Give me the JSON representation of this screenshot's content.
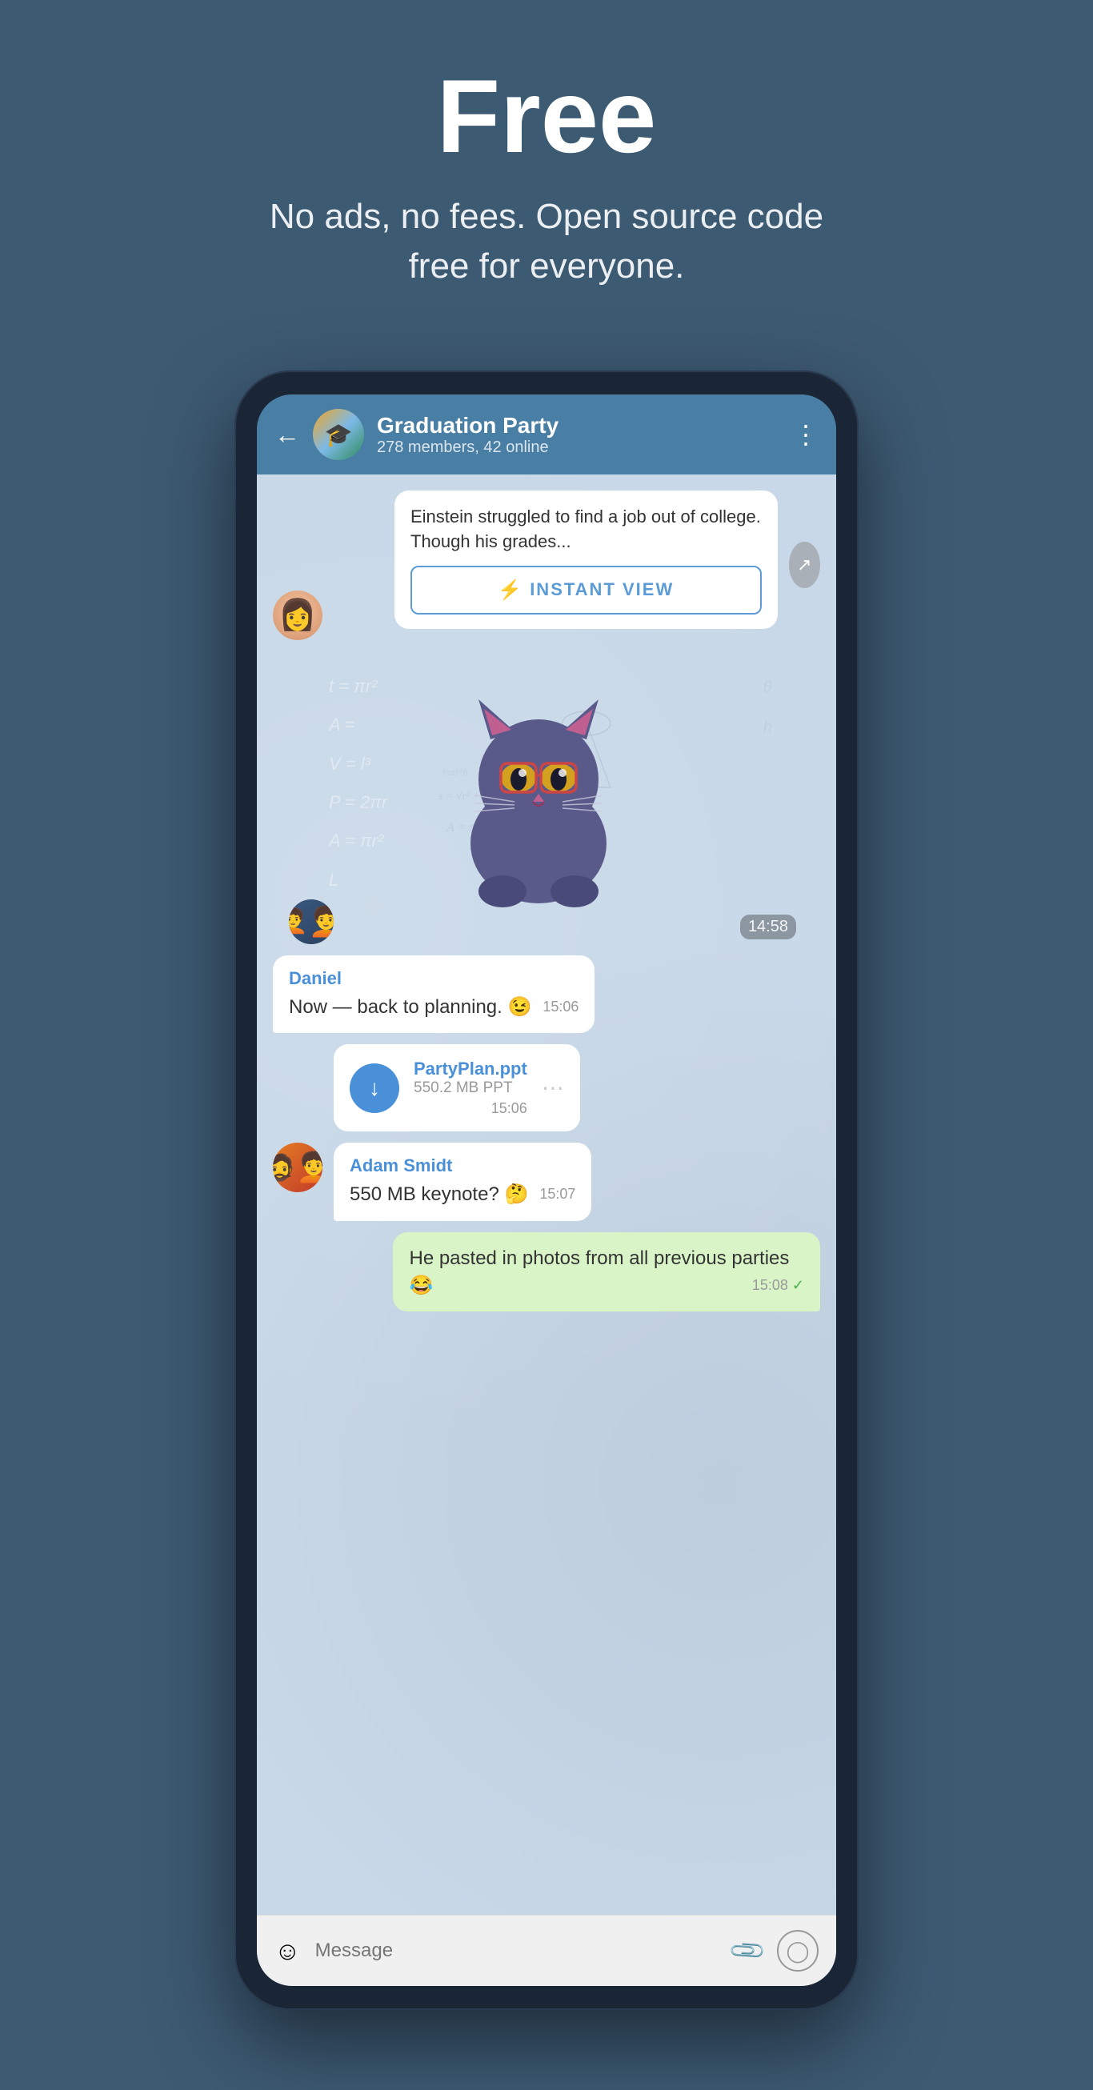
{
  "hero": {
    "title": "Free",
    "subtitle": "No ads, no fees. Open source code free for everyone."
  },
  "phone": {
    "header": {
      "back_label": "←",
      "group_name": "Graduation Party",
      "group_members": "278 members, 42 online",
      "menu_label": "⋮"
    },
    "messages": [
      {
        "type": "instant_view",
        "text": "Einstein struggled to find a job out of college. Though his grades...",
        "button_label": "INSTANT VIEW",
        "lightning": "⚡"
      },
      {
        "type": "sticker",
        "time": "14:58"
      },
      {
        "type": "text",
        "sender": "Daniel",
        "text": "Now — back to planning. 😉",
        "time": "15:06"
      },
      {
        "type": "file",
        "sender": "",
        "file_name": "PartyPlan.ppt",
        "file_size": "550.2 MB PPT",
        "time": "15:06"
      },
      {
        "type": "text",
        "sender": "Adam Smidt",
        "text": "550 MB keynote? 🤔",
        "time": "15:07"
      },
      {
        "type": "outgoing",
        "text": "He pasted in photos from all previous parties 😂",
        "time": "15:08",
        "status": "✓"
      }
    ],
    "input": {
      "placeholder": "Message",
      "emoji_icon": "☺",
      "attach_icon": "📎",
      "camera_icon": "📷"
    },
    "math_formulas": [
      "t = πr²",
      "A =",
      "V = l³",
      "P = 2πr",
      "A = πr²",
      "s = √r² + h²",
      "A = πr² + πrs"
    ]
  }
}
